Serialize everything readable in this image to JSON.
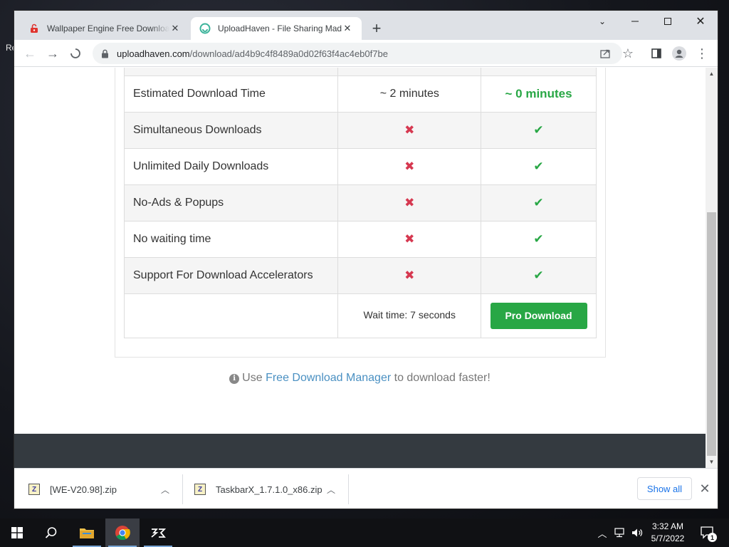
{
  "desktop": {
    "left_text": "Re"
  },
  "browser": {
    "tabs": [
      {
        "title": "Wallpaper Engine Free Download",
        "favicon": "red-lock-icon",
        "active": false
      },
      {
        "title": "UploadHaven - File Sharing Made",
        "favicon": "uploadhaven-icon",
        "active": true
      }
    ],
    "new_tab_symbol": "+",
    "url_host": "uploadhaven.com",
    "url_path": "/download/ad4b9c4f8489a0d02f63f4ac4eb0f7be"
  },
  "comparison": {
    "rows": [
      {
        "feature": "Estimated Download Time",
        "free": "~ 2 minutes",
        "pro": "~ 0 minutes"
      },
      {
        "feature": "Simultaneous Downloads",
        "free": "✖",
        "pro": "✔"
      },
      {
        "feature": "Unlimited Daily Downloads",
        "free": "✖",
        "pro": "✔"
      },
      {
        "feature": "No-Ads & Popups",
        "free": "✖",
        "pro": "✔"
      },
      {
        "feature": "No waiting time",
        "free": "✖",
        "pro": "✔"
      },
      {
        "feature": "Support For Download Accelerators",
        "free": "✖",
        "pro": "✔"
      }
    ],
    "wait_text": "Wait time: 7 seconds",
    "pro_button": "Pro Download"
  },
  "fdm_note": {
    "prefix": "Use ",
    "link": "Free Download Manager",
    "suffix": " to download faster!"
  },
  "downloads": [
    {
      "filename": "[WE-V20.98].zip"
    },
    {
      "filename": "TaskbarX_1.7.1.0_x86.zip"
    }
  ],
  "shelf": {
    "show_all": "Show all"
  },
  "taskbar": {
    "time": "3:32 AM",
    "date": "5/7/2022",
    "notification_count": "1"
  },
  "colors": {
    "pro_green": "#28a745",
    "free_red": "#d63850",
    "link_blue": "#4a90c2",
    "footer": "#343a40"
  }
}
